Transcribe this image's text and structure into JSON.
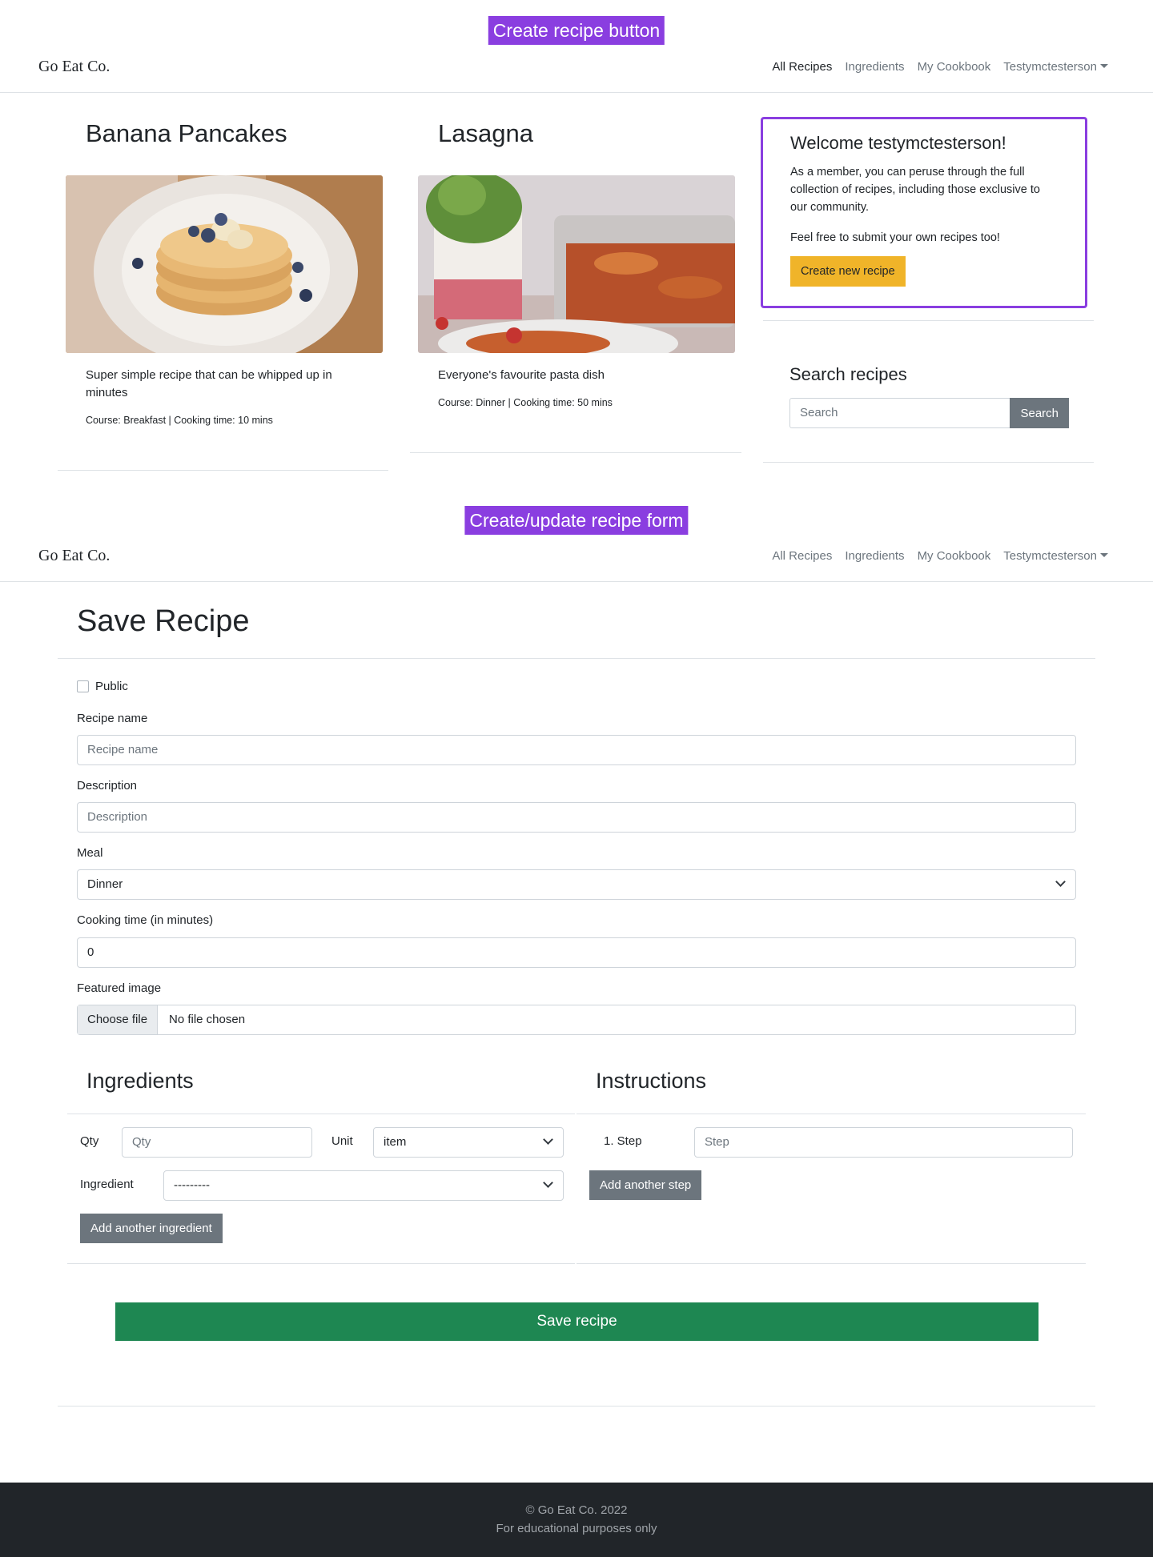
{
  "annotations": {
    "create_button": "Create recipe button",
    "form": "Create/update recipe form"
  },
  "navbar": {
    "brand": "Go Eat Co.",
    "links": [
      "All Recipes",
      "Ingredients",
      "My Cookbook",
      "Testymctesterson"
    ]
  },
  "recipes": [
    {
      "title": "Banana Pancakes",
      "description": "Super simple recipe that can be whipped up in minutes",
      "meta": "Course: Breakfast | Cooking time: 10 mins"
    },
    {
      "title": "Lasagna",
      "description": "Everyone's favourite pasta dish",
      "meta": "Course: Dinner | Cooking time: 50 mins"
    }
  ],
  "welcome": {
    "title": "Welcome testymctesterson!",
    "text1": "As a member, you can peruse through the full collection of recipes, including those exclusive to our community.",
    "text2": "Feel free to submit your own recipes too!",
    "button": "Create new recipe"
  },
  "search": {
    "title": "Search recipes",
    "placeholder": "Search",
    "button": "Search"
  },
  "form": {
    "title": "Save Recipe",
    "public_label": "Public",
    "name_label": "Recipe name",
    "name_placeholder": "Recipe name",
    "desc_label": "Description",
    "desc_placeholder": "Description",
    "meal_label": "Meal",
    "meal_value": "Dinner",
    "time_label": "Cooking time (in minutes)",
    "time_value": "0",
    "image_label": "Featured image",
    "file_button": "Choose file",
    "file_text": "No file chosen"
  },
  "ingredients": {
    "title": "Ingredients",
    "qty_label": "Qty",
    "qty_placeholder": "Qty",
    "unit_label": "Unit",
    "unit_value": "item",
    "ingredient_label": "Ingredient",
    "ingredient_value": "---------",
    "add_button": "Add another ingredient"
  },
  "instructions": {
    "title": "Instructions",
    "step_label": "1. Step",
    "step_placeholder": "Step",
    "add_button": "Add another step"
  },
  "save_button": "Save recipe",
  "footer": {
    "line1": "© Go Eat Co. 2022",
    "line2": "For educational purposes only"
  },
  "colors": {
    "annotation": "#8a3ee0",
    "warning": "#f0b429",
    "secondary": "#6c757d",
    "success": "#1e8752",
    "footer": "#212529"
  }
}
